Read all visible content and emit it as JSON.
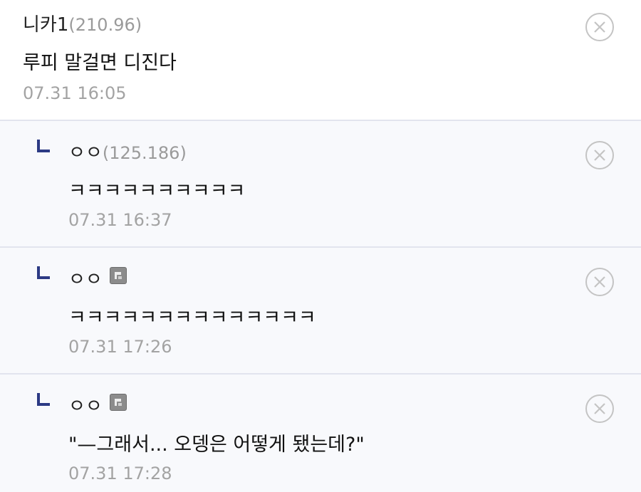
{
  "comments": [
    {
      "nick": "니카1",
      "ip": "(210.96)",
      "text": "루피 말걸면 디진다",
      "date": "07.31 16:05"
    },
    {
      "nick": "ㅇㅇ",
      "ip": "(125.186)",
      "text": "ㅋㅋㅋㅋㅋㅋㅋㅋㅋㅋ",
      "date": "07.31 16:37"
    },
    {
      "nick": "ㅇㅇ",
      "text": "ㅋㅋㅋㅋㅋㅋㅋㅋㅋㅋㅋㅋㅋㅋ",
      "date": "07.31 17:26"
    },
    {
      "nick": "ㅇㅇ",
      "text": "\"—그래서... 오뎅은 어떻게 됐는데?\"",
      "date": "07.31 17:28"
    }
  ],
  "icons": {
    "delete": "close-circle-icon",
    "reply": "reply-arrow-icon",
    "fixed_nick": "fixed-nick-icon"
  },
  "colors": {
    "reply_arrow": "#2c3a84",
    "date_text": "#a3a3a3",
    "ip_text": "#9a9a9a",
    "reply_bg": "#f8f9fc",
    "divider": "#e2e4ee",
    "delete_icon": "#c4c4c4"
  }
}
